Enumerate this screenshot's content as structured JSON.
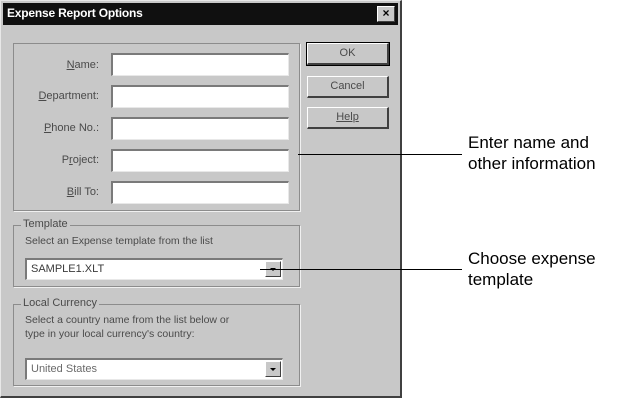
{
  "dialog": {
    "title": "Expense Report Options",
    "close_symbol": "×"
  },
  "fields": [
    {
      "label_mnemonic": "N",
      "label_rest": "ame:",
      "value": ""
    },
    {
      "label_mnemonic": "D",
      "label_rest": "epartment:",
      "value": ""
    },
    {
      "label_mnemonic": "P",
      "label_rest": "hone No.:",
      "value": ""
    },
    {
      "label_pre": "P",
      "label_mnemonic": "r",
      "label_rest": "oject:",
      "value": ""
    },
    {
      "label_mnemonic": "B",
      "label_rest": "ill To:",
      "value": ""
    }
  ],
  "buttons": {
    "ok": "OK",
    "cancel": "Cancel",
    "help": "Help"
  },
  "template": {
    "group_label": "Template",
    "description": "Select an Expense template from the list",
    "selected": "SAMPLE1.XLT"
  },
  "currency": {
    "group_label": "Local Currency",
    "description_line1": "Select a country name from the list below or",
    "description_line2": "type in your local currency's country:",
    "selected": "United States"
  },
  "callouts": {
    "info_line1": "Enter name and",
    "info_line2": "other information",
    "template_line1": "Choose expense",
    "template_line2": "template"
  }
}
